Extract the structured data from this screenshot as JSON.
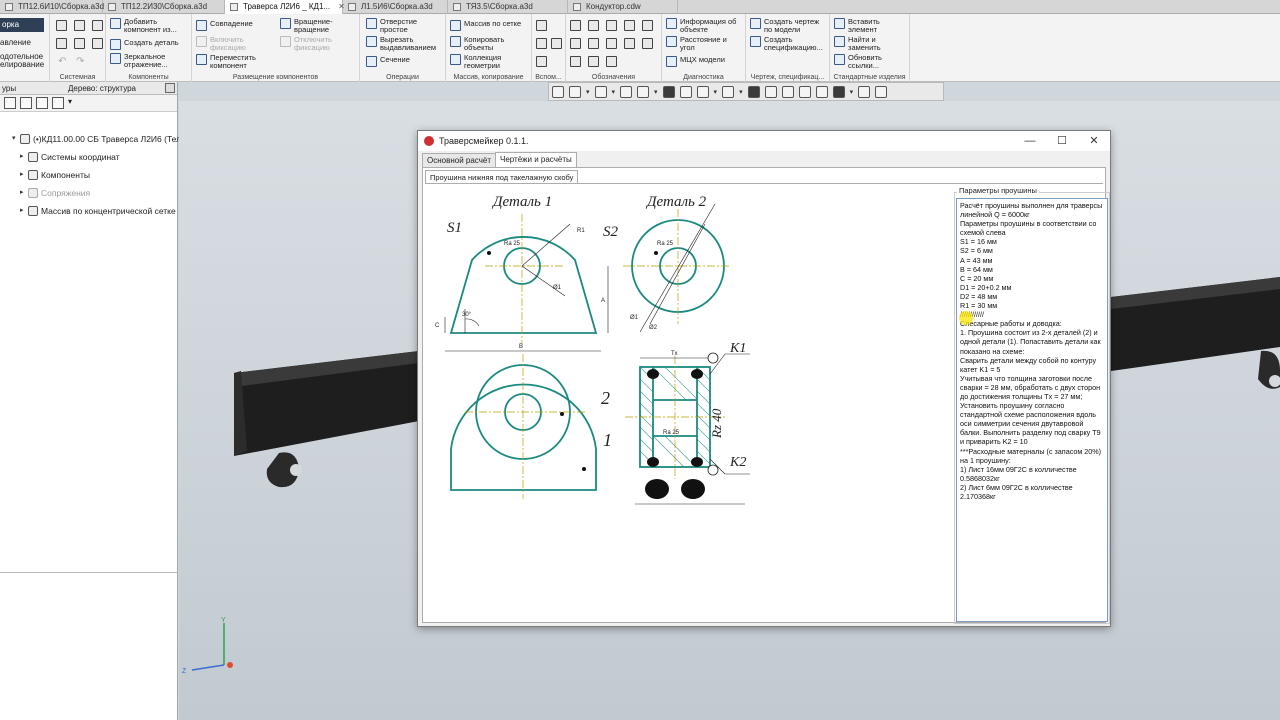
{
  "doc_tabs": [
    {
      "label": "ТП12.6И10\\Сборка.a3d",
      "active": false
    },
    {
      "label": "ТП12.2И30\\Сборка.a3d",
      "active": false
    },
    {
      "label": "Траверса Л2И6 _ КД1...",
      "active": true
    },
    {
      "label": "Л1.5И6\\Сборка.a3d",
      "active": false
    },
    {
      "label": "ТЯ3.5\\Сборка.a3d",
      "active": false
    },
    {
      "label": "Кондуктор.cdw",
      "active": false
    }
  ],
  "ribbon": {
    "left": {
      "header": "орка",
      "l1": "авление",
      "l2": "одотельное",
      "l3": "елирование"
    },
    "groups": {
      "system": "Системная",
      "components": "Компоненты",
      "placement": "Размещение компонентов",
      "operations": "Операции",
      "arrays": "Массив, копирование",
      "aux": "Вспом...",
      "marks": "Обозначения",
      "diagnostics": "Диагностика",
      "drawing_spec": "Чертеж, спецификац...",
      "std_products": "Стандартные изделия"
    },
    "buttons": {
      "add_component": "Добавить\nкомпонент из...",
      "create_detail": "Создать деталь",
      "mirror": "Зеркальное\nотражение...",
      "coincidence": "Совпадение",
      "enable_fix": "Включить\nфиксацию",
      "rotation_rotation": "Вращение-\nвращение",
      "disable_fix": "Отключить\nфиксацию",
      "move_component": "Переместить\nкомпонент",
      "hole_simple": "Отверстие\nпростое",
      "cut_extrude": "Вырезать\nвыдавливанием",
      "section": "Сечение",
      "array_grid": "Массив по сетке",
      "copy_objects": "Копировать\nобъекты",
      "geometry_collection": "Коллекция\nгеометрии",
      "object_info": "Информация об\nобъекте",
      "distance_angle": "Расстояние и\nугол",
      "mcc_model": "МЦХ модели",
      "create_drawing": "Создать чертеж\nпо модели",
      "create_spec": "Создать\nспецификацию...",
      "insert_element": "Вставить\nэлемент",
      "find_replace": "Найти и\nзаменить",
      "update_links": "Обновить\nссылки..."
    }
  },
  "sidebar": {
    "header_left": "уры",
    "header_tab": "Дерево: структура",
    "tree": [
      {
        "label": "(•)КД11.00.00 СБ Траверса Л2И6 (Тел-",
        "level": 0,
        "disabled": false
      },
      {
        "label": "Системы координат",
        "level": 1,
        "disabled": false
      },
      {
        "label": "Компоненты",
        "level": 1,
        "disabled": false
      },
      {
        "label": "Сопряжения",
        "level": 1,
        "disabled": true
      },
      {
        "label": "Массив по концентрической сетке",
        "level": 1,
        "disabled": false
      }
    ]
  },
  "dialog": {
    "title": "Траверсмейкер 0.1.1.",
    "tabs": [
      "Основной расчёт",
      "Чертёжи и расчёты"
    ],
    "active_tab": 1,
    "subtab": "Проушина нижняя под такелажную скобу",
    "groupbox_label": "Параметры проушины",
    "text": "Расчёт проушины выполнен для траверсы линейной Q = 6000кг\nПараметры проушины в соответствии со схемой слева\nS1 = 16 мм\nS2 = 6 мм\nA = 43 мм\nB = 64 мм\nC = 20 мм\nD1 = 20+0.2 мм\nD2 = 48 мм\nR1 = 30 мм\n////////////\nСлесарные работы и доводка:\n1. Проушина состоит из 2-х деталей (2) и одной детали (1). Попаставить детали как показано на схеме:\nСварить детали между собой по контуру катет K1 = 5\nУчитывая что толщина заготовки после сварки = 28 мм, обработать с двух сторон до достижения толщины Tx = 27 мм;\nУстановить проушину согласно стандартной схеме расположения вдоль оси симметрии сечения двутавровой балки. Выполнить разделку под сварку Т9 и приварить K2 = 10\n***Расходные матерналы (с запасом 20%) на 1 проушину:\n1) Лист 16мм 09Г2С в колличестве 0.5868032кг\n2) Лист 6мм 09Г2С в колличестве 2.170368кг"
  },
  "drawing_labels": {
    "detail1": "Деталь 1",
    "detail2": "Деталь 2",
    "s1": "S1",
    "s2": "S2",
    "r1": "R1",
    "d1": "Ø1",
    "d2": "Ø2",
    "a": "A",
    "b": "B",
    "c": "C",
    "angle": "30°",
    "ra25": "Ra 25",
    "ra25b": "Ra 25",
    "rz40": "Rz 40",
    "tx": "Tx",
    "k1": "K1",
    "k2": "K2",
    "n1": "1",
    "n2": "2"
  },
  "colors": {
    "accent": "#2b3f57",
    "drawing": "#1a8a80",
    "axis": "#b8a000"
  }
}
